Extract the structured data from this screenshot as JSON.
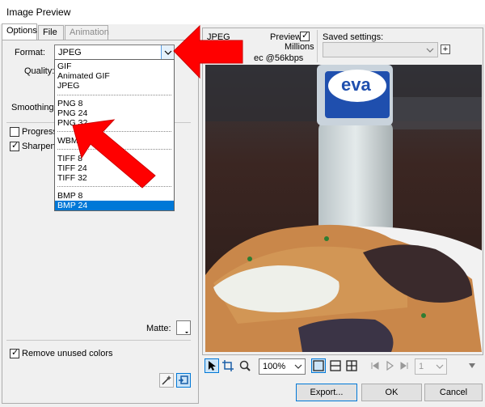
{
  "window": {
    "title": "Image Preview"
  },
  "tabs": [
    {
      "label": "Options"
    },
    {
      "label": "File"
    },
    {
      "label": "Animation"
    }
  ],
  "options": {
    "format_label": "Format:",
    "format_value": "JPEG",
    "quality_label": "Quality:",
    "smoothing_label": "Smoothing:",
    "progressive_label": "Progressive",
    "sharpen_label": "Sharpen c",
    "matte_label": "Matte:",
    "remove_unused_label": "Remove unused colors"
  },
  "format_dropdown": {
    "groups": [
      [
        "GIF",
        "Animated GIF",
        "JPEG"
      ],
      [
        "PNG 8",
        "PNG 24",
        "PNG 32"
      ],
      [
        "WBMP"
      ],
      [
        "TIFF 8",
        "TIFF 24",
        "TIFF 32"
      ],
      [
        "BMP 8",
        "BMP 24"
      ]
    ],
    "selected": "BMP 24"
  },
  "preview_info": {
    "format": "JPEG",
    "preview_label": "Preview",
    "colors": "Millions",
    "timing": "ec @56kbps"
  },
  "saved_settings": {
    "label": "Saved settings:",
    "value": ""
  },
  "toolbar": {
    "zoom": "100%",
    "frame": "1",
    "export_label": "Export...",
    "ok_label": "OK",
    "cancel_label": "Cancel"
  },
  "photo": {
    "bottle_text": "eva"
  },
  "colors": {
    "accent": "#0078d7",
    "arrow": "#ff0000",
    "select_hl": "#0078d7"
  }
}
